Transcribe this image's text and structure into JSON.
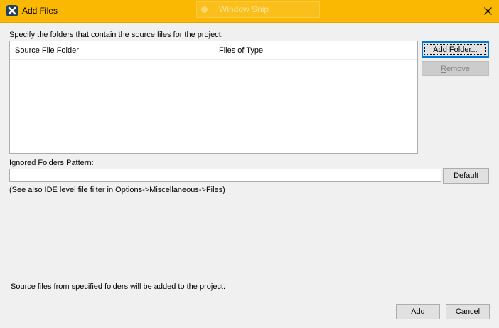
{
  "window": {
    "title": "Add Files",
    "overlay_title": "Window Snip",
    "titlebar_color": "#fbb803"
  },
  "main": {
    "folders_label": "Specify the folders that contain the source files for the project:",
    "folders_label_mnemonic": "S",
    "folders_label_rest": "pecify the folders that contain the source files for the project:",
    "table": {
      "columns": [
        "Source File Folder",
        "Files of Type"
      ],
      "rows": []
    },
    "ignored_label": "Ignored Folders Pattern:",
    "ignored_label_mnemonic": "I",
    "ignored_label_rest": "gnored Folders Pattern:",
    "ignored_pattern_value": "",
    "hint": "(See also IDE level file filter in Options->Miscellaneous->Files)",
    "footer_note": "Source files from specified folders will be added to the project."
  },
  "buttons": {
    "add_folder": {
      "label": "Add Folder...",
      "mnemonic": "A",
      "rest": "dd Folder..."
    },
    "remove": {
      "label": "Remove",
      "mnemonic": "R",
      "rest": "emove",
      "enabled": false
    },
    "default": {
      "label": "Default",
      "pre": "Defa",
      "mnemonic": "u",
      "rest": "lt"
    },
    "add": {
      "label": "Add"
    },
    "cancel": {
      "label": "Cancel"
    }
  },
  "icons": {
    "app": "app-icon",
    "close": "close-icon",
    "snip": "snip-icon"
  }
}
